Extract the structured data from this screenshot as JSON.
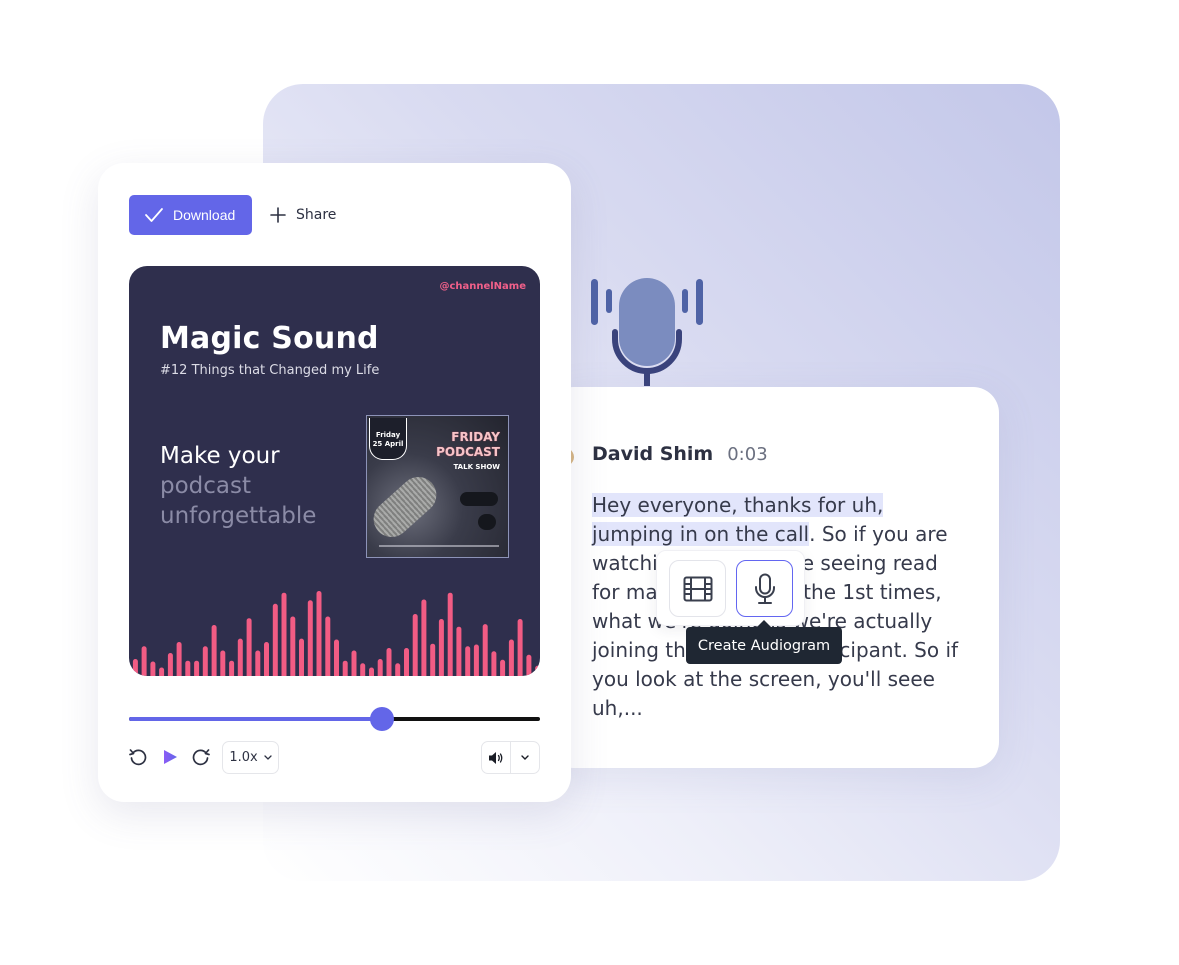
{
  "colors": {
    "accent": "#6366e8",
    "cover_bg": "#2f2f4d",
    "wave": "#f25c84",
    "channel": "#f2608a",
    "tooltip_bg": "#1f2733",
    "highlight": "#e2e5fb"
  },
  "player": {
    "download_label": "Download",
    "download_icon": "check-icon",
    "share_label": "Share",
    "share_icon": "plus-icon",
    "cover": {
      "channel": "@channelName",
      "title": "Magic Sound",
      "subtitle": "#12 Things that Changed my Life",
      "tagline_line1": "Make your",
      "tagline_line2": "podcast",
      "tagline_line3": "unforgettable",
      "thumbnail": {
        "date_line1": "Friday",
        "date_line2": "25 April",
        "headline1": "FRIDAY",
        "headline2": "PODCAST",
        "subhead": "TALK SHOW"
      },
      "waveform_levels": [
        0.2,
        0.35,
        0.17,
        0.1,
        0.27,
        0.4,
        0.18,
        0.18,
        0.35,
        0.6,
        0.3,
        0.18,
        0.44,
        0.68,
        0.3,
        0.4,
        0.85,
        0.98,
        0.7,
        0.44,
        0.89,
        1.0,
        0.7,
        0.43,
        0.18,
        0.3,
        0.15,
        0.1,
        0.2,
        0.33,
        0.15,
        0.33,
        0.73,
        0.9,
        0.38,
        0.67,
        0.98,
        0.58,
        0.35,
        0.37,
        0.61,
        0.29,
        0.19,
        0.43,
        0.67,
        0.25,
        0.12
      ]
    },
    "progress": 0.615,
    "speed": "1.0x",
    "controls": {
      "rewind_icon": "rewind-icon",
      "play_icon": "play-icon",
      "forward_icon": "forward-icon",
      "volume_icon": "volume-icon",
      "volume_menu_icon": "chevron-down-icon"
    }
  },
  "transcript": {
    "speaker": "David Shim",
    "timestamp": "0:03",
    "highlighted_text": "Hey everyone, thanks for uh, jumping in on the call",
    "text_rest": ". So if you are watching this, you are seeing read for maybe, or one of the 1st times, what we're doing is we're actually joining the call as a participant. So if you look at the screen, you'll seee uh,..."
  },
  "toolbar": {
    "video_icon": "film-icon",
    "audiogram_icon": "microphone-icon",
    "tooltip": "Create Audiogram"
  },
  "decor": {
    "big_icon": "microphone-waves-icon"
  }
}
